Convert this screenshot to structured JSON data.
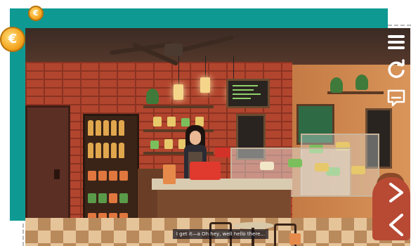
{
  "caption": {
    "text": "I get it—a Oh hey, well hello there..."
  },
  "coins": {
    "small_symbol": "€",
    "large_symbol": "€"
  },
  "controls": {
    "menu_icon": "hamburger-icon",
    "restart_icon": "refresh-icon",
    "subtitles_icon": "subtitles-icon",
    "next_icon": "chevron-right-icon",
    "collapse_icon": "chevron-left-icon"
  },
  "colors": {
    "frame_teal": "#0e9a93",
    "coin_gold": "#f5a623",
    "brick": "#b2452e",
    "register_red": "#e0392e"
  }
}
